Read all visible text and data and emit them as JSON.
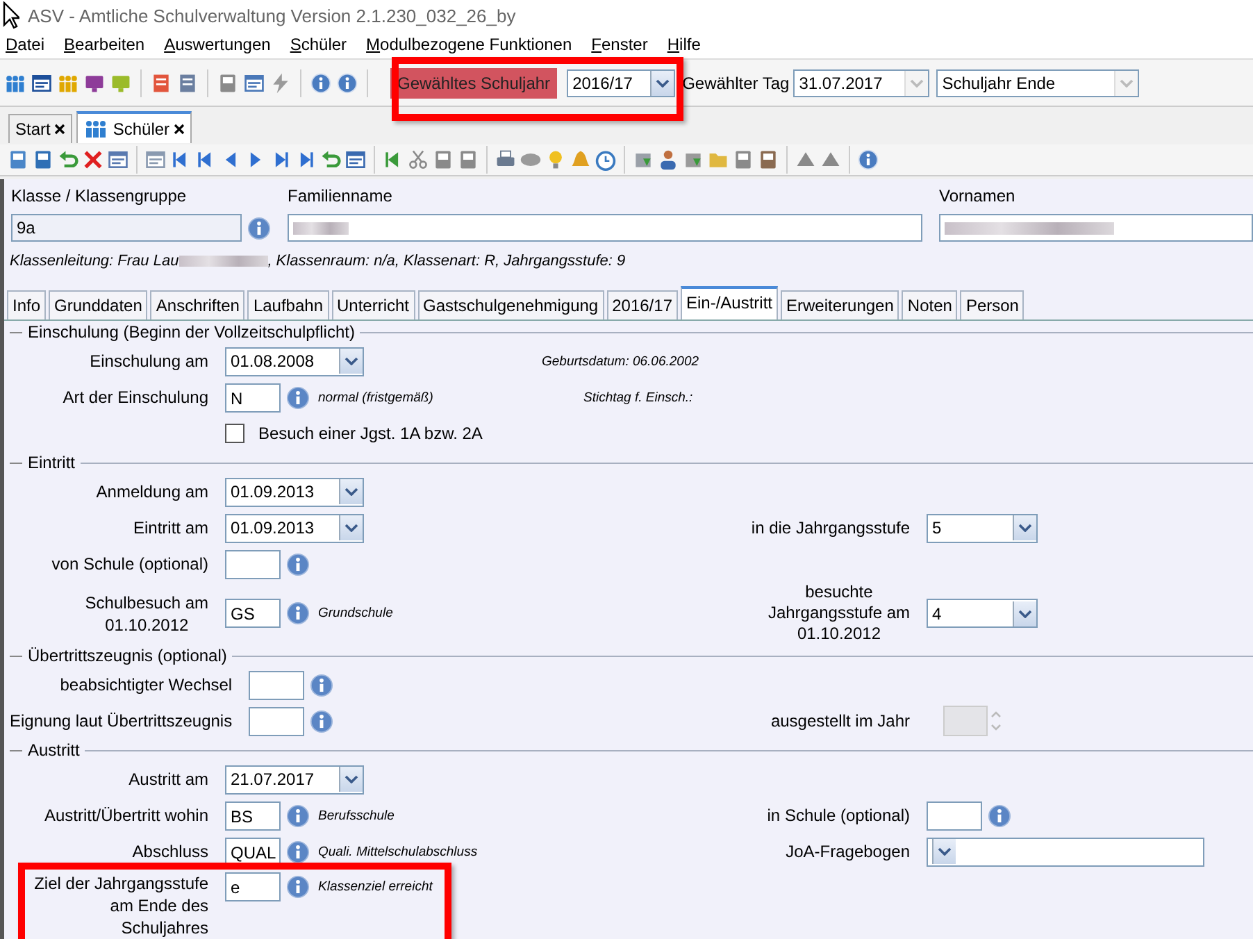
{
  "window": {
    "title": "ASV - Amtliche Schulverwaltung Version 2.1.230_032_26_by"
  },
  "menu": [
    {
      "label": "Datei"
    },
    {
      "label": "Bearbeiten"
    },
    {
      "label": "Auswertungen"
    },
    {
      "label": "Schüler"
    },
    {
      "label": "Modulbezogene Funktionen"
    },
    {
      "label": "Fenster"
    },
    {
      "label": "Hilfe"
    }
  ],
  "toolbar": {
    "schuljahr_label": "Gewähltes Schuljahr",
    "schuljahr": "2016/17",
    "tag_label": "Gewählter Tag",
    "tag": "31.07.2017",
    "tag_mode": "Schuljahr Ende"
  },
  "doc_tabs": [
    {
      "label": "Start",
      "selected": false
    },
    {
      "label": "Schüler",
      "selected": true
    }
  ],
  "header": {
    "klasse_label": "Klasse / Klassengruppe",
    "klasse": "9a",
    "familienname_label": "Familienname",
    "vornamen_label": "Vornamen",
    "info_prefix": "Klassenleitung: Frau Lau",
    "info_rest": ", Klassenraum: n/a, Klassenart: R, Jahrgangsstufe: 9"
  },
  "tabs": [
    {
      "label": "Info",
      "selected": false
    },
    {
      "label": "Grunddaten",
      "selected": false
    },
    {
      "label": "Anschriften",
      "selected": false
    },
    {
      "label": "Laufbahn",
      "selected": false
    },
    {
      "label": "Unterricht",
      "selected": false
    },
    {
      "label": "Gastschulgenehmigung",
      "selected": false
    },
    {
      "label": "2016/17",
      "selected": false
    },
    {
      "label": "Ein-/Austritt",
      "selected": true
    },
    {
      "label": "Erweiterungen",
      "selected": false
    },
    {
      "label": "Noten",
      "selected": false
    },
    {
      "label": "Person",
      "selected": false
    }
  ],
  "sections": [
    {
      "title": "Einschulung (Beginn der Vollzeitschulpflicht)",
      "rows": [
        {
          "kind": "date",
          "label": [
            "Einschulung am"
          ],
          "value": "01.08.2008",
          "right": {
            "kind": "note",
            "text": "Geburtsdatum: 06.06.2002"
          }
        },
        {
          "kind": "code",
          "label": [
            "Art der Einschulung"
          ],
          "value": "N",
          "note": "normal (fristgemäß)",
          "right": {
            "kind": "note",
            "text": "Stichtag f. Einsch.:"
          }
        },
        {
          "kind": "checkbox",
          "text": "Besuch einer Jgst. 1A bzw. 2A",
          "checked": false
        }
      ]
    },
    {
      "title": "Eintritt",
      "rows": [
        {
          "kind": "date",
          "label": [
            "Anmeldung am"
          ],
          "value": "01.09.2013"
        },
        {
          "kind": "date",
          "label": [
            "Eintritt am"
          ],
          "value": "01.09.2013",
          "right": {
            "kind": "combo",
            "label": [
              "in die Jahrgangsstufe"
            ],
            "value": "5"
          }
        },
        {
          "kind": "code",
          "label": [
            "von Schule (optional)"
          ]
        },
        {
          "kind": "code",
          "label": [
            "Schulbesuch am",
            "01.10.2012"
          ],
          "value": "GS",
          "note": "Grundschule",
          "right": {
            "kind": "combo",
            "label": [
              "besuchte",
              "Jahrgangsstufe am",
              "01.10.2012"
            ],
            "value": "4"
          }
        }
      ]
    },
    {
      "title": "Übertrittszeugnis (optional)",
      "rows": [
        {
          "kind": "code",
          "label": [
            "beabsichtigter Wechsel"
          ]
        },
        {
          "kind": "code",
          "label": [
            "Eignung laut Übertrittszeugnis"
          ],
          "right": {
            "kind": "spinner",
            "label": [
              "ausgestellt im Jahr"
            ]
          }
        }
      ]
    },
    {
      "title": "Austritt",
      "rows": [
        {
          "kind": "date",
          "label": [
            "Austritt am"
          ],
          "value": "21.07.2017"
        },
        {
          "kind": "code",
          "label": [
            "Austritt/Übertritt wohin"
          ],
          "value": "BS",
          "note": "Berufsschule",
          "right": {
            "kind": "code",
            "label": [
              "in Schule (optional)"
            ]
          }
        },
        {
          "kind": "code",
          "label": [
            "Abschluss"
          ],
          "value": "QUAL",
          "note": "Quali. Mittelschulabschluss",
          "right": {
            "kind": "wide_combo",
            "label": [
              "JoA-Fragebogen"
            ]
          }
        },
        {
          "kind": "code",
          "label": [
            "Ziel der Jahrgangsstufe",
            "am Ende des",
            "Schuljahres"
          ],
          "value": "e",
          "note": "Klassenziel erreicht"
        }
      ]
    }
  ]
}
